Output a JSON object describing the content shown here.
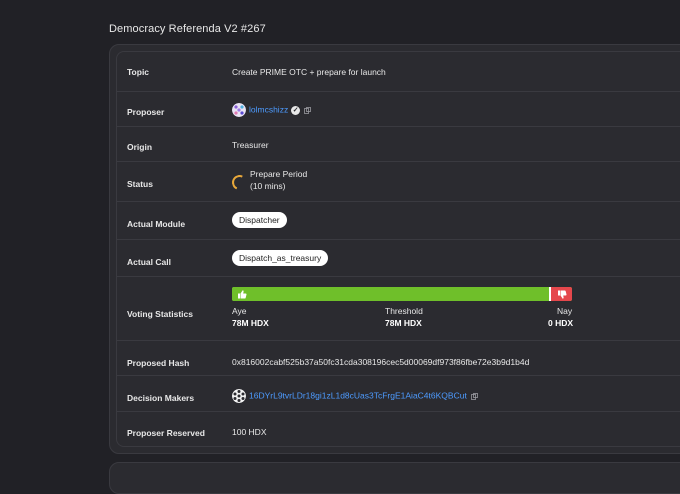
{
  "title": "Democracy Referenda V2 #267",
  "rows": {
    "topic": {
      "label": "Topic",
      "value": "Create PRIME OTC + prepare for launch"
    },
    "proposer": {
      "label": "Proposer",
      "value": "lolmcshizz"
    },
    "origin": {
      "label": "Origin",
      "value": "Treasurer"
    },
    "status": {
      "label": "Status",
      "line1": "Prepare Period",
      "line2": "(10 mins)"
    },
    "module": {
      "label": "Actual Module",
      "value": "Dispatcher"
    },
    "call": {
      "label": "Actual Call",
      "value": "Dispatch_as_treasury"
    },
    "voting": {
      "label": "Voting Statistics",
      "aye_label": "Aye",
      "aye_value": "78M HDX",
      "threshold_label": "Threshold",
      "threshold_value": "78M HDX",
      "nay_label": "Nay",
      "nay_value": "0 HDX",
      "aye_fraction": 0.93,
      "threshold_fraction": 0.935
    },
    "hash": {
      "label": "Proposed Hash",
      "value": "0x816002cabf525b37a50fc31cda308196cec5d00069df973f86fbe72e3b9d1b4d"
    },
    "decision": {
      "label": "Decision Makers",
      "value": "16DYrL9tvrLDr18gi1zL1d8cUas3TcFrgE1AiaC4t6KQBCut"
    },
    "reserved": {
      "label": "Proposer Reserved",
      "value": "100 HDX"
    }
  },
  "colors": {
    "aye": "#6fbf2a",
    "nay": "#e5474c",
    "link": "#4d9bff",
    "status": "#e8a83a"
  }
}
